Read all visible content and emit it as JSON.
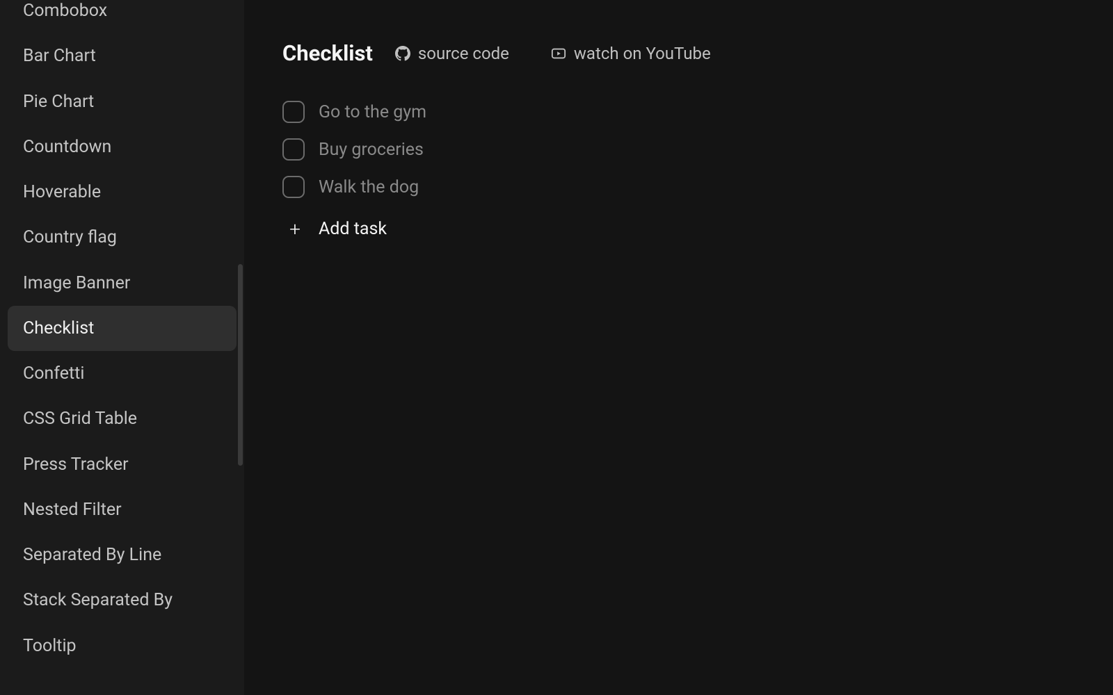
{
  "sidebar": {
    "items": [
      {
        "label": "Combobox",
        "active": false,
        "partial": true
      },
      {
        "label": "Bar Chart",
        "active": false
      },
      {
        "label": "Pie Chart",
        "active": false
      },
      {
        "label": "Countdown",
        "active": false
      },
      {
        "label": "Hoverable",
        "active": false
      },
      {
        "label": "Country flag",
        "active": false
      },
      {
        "label": "Image Banner",
        "active": false
      },
      {
        "label": "Checklist",
        "active": true
      },
      {
        "label": "Confetti",
        "active": false
      },
      {
        "label": "CSS Grid Table",
        "active": false
      },
      {
        "label": "Press Tracker",
        "active": false
      },
      {
        "label": "Nested Filter",
        "active": false
      },
      {
        "label": "Separated By Line",
        "active": false
      },
      {
        "label": "Stack Separated By",
        "active": false
      },
      {
        "label": "Tooltip",
        "active": false
      }
    ]
  },
  "header": {
    "title": "Checklist",
    "source_link": "source code",
    "youtube_link": "watch on YouTube"
  },
  "tasks": [
    {
      "label": "Go to the gym"
    },
    {
      "label": "Buy groceries"
    },
    {
      "label": "Walk the dog"
    }
  ],
  "add_task_label": "Add task"
}
